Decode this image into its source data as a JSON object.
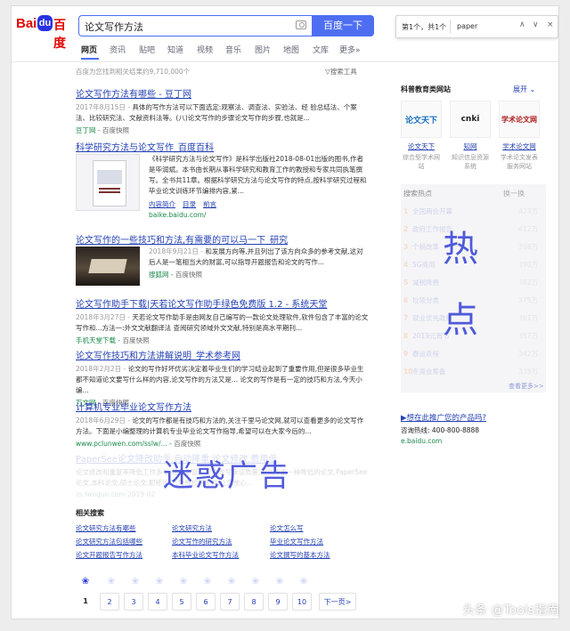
{
  "header": {
    "logo_left": "Bai",
    "logo_paw": "du",
    "logo_right": "百度",
    "query": "论文写作方法",
    "search_button": "百度一下"
  },
  "findbar": {
    "count": "第1个，共1个",
    "term": "paper",
    "up": "∧",
    "down": "∨",
    "close": "×"
  },
  "nav": [
    "网页",
    "资讯",
    "贴吧",
    "知道",
    "视频",
    "音乐",
    "图片",
    "地图",
    "文库",
    "更多»"
  ],
  "result_count": "百度为您找到相关结果约9,710,000个",
  "search_tools": "搜索工具",
  "results": [
    {
      "title": "论文写作方法有哪些 - 豆丁网",
      "date": "2017年8月15日 -",
      "desc": "具体的写作方法可以下面选定:观察法、调查法、实验法、经 验总结法、个案法、比较研究法、文献资料法等。(八)论文写作的步骤论文写作的步骤,也就是...",
      "source": "豆丁网",
      "cache": "百度快照"
    },
    {
      "title": "科学研究方法与论文写作_百度百科",
      "desc": "《科学研究方法与论文写作》是科学出版社2018-08-01出版的图书,作者是毕润斌。本书由长期从事科学研究和教育工作的教授和专家共同执笔撰写。全书共11章。根据科学研究方法与论文写作的特点,按科学研究过程和毕业论文训练环节编排内容,紧...",
      "links": [
        "内容简介",
        "目录",
        "前言"
      ],
      "source": "baike.baidu.com/"
    },
    {
      "title": "论文写作的一些技巧和方法,有需要的可以马一下_研究",
      "date": "2018年9月21日 -",
      "desc": "和发展方向等,并且列出了该方向众多的参考文献,这对后人是一笔相当大的财富,可以指导开题报告和论文的写作...",
      "source": "搜狐网",
      "cache": "百度快照"
    },
    {
      "title": "论文写作助手下载|天若论文写作助手绿色免费版 1.2 - 系统天堂",
      "date": "2018年3月27日 -",
      "desc": "天若论文写作助手是由网友自己编写的一款论文处理软件,软件包含了丰富的论文写作和...方法一:外文文献翻译法 查阅研究领域外文文献,特别是高水平期刊...",
      "source": "手机天堂下载",
      "cache": "百度快照"
    },
    {
      "title": "论文写作技巧和方法讲解说明_学术参考网",
      "date": "2018年2月2日 -",
      "desc": "论文的写作好坏优劣决定着毕业生们的学习结业起到了重要作用,但是很多毕业生都不知道论文要写什么样的内容,论文写作的方法又是... 论文的写作是有一定的技巧和方法,今天小编...",
      "source": "万文网",
      "cache": "百度快照"
    },
    {
      "title": "计算机专业毕业论文写作方法",
      "date": "2018年6月29日 -",
      "desc": "论文的写作都是有技巧和方法的,关注千里马论文网,就可以查看更多的论文写作方法。下面是小编整理的计算机专业毕业论文写作指导,希望可以在大家今后的...",
      "source": "www.pclunwen.com/sslw/...",
      "cache": "百度快照"
    },
    {
      "title": "PaperSee论文降改助手,自动降重,论文修改,费用低",
      "desc": "论文修改和重复率降低工作多年,经验丰富。论文改写保证质量,论文降重一种降低的论文,PaperSee论文,本科论文,硕士论文,职称论文,免费检测论文,让您放心...",
      "source": "zs.lwnguo.com",
      "cache": "2019-02"
    }
  ],
  "overlays": {
    "ad": "迷惑广告",
    "hot_1": "热",
    "hot_2": "点"
  },
  "related": {
    "title": "相关搜索",
    "items": [
      "论文研究方法有哪些",
      "论文研究方法",
      "论文怎么写",
      "论文研究方法包括哪些",
      "论文写作的研究方法",
      "毕业论文写作方法",
      "论文开题报告写作方法",
      "本科毕业论文写作方法",
      "论文撰写的基本方法"
    ]
  },
  "pagination": {
    "pages": [
      "1",
      "2",
      "3",
      "4",
      "5",
      "6",
      "7",
      "8",
      "9",
      "10"
    ],
    "current": "1",
    "next": "下一页>"
  },
  "sidebar": {
    "title": "科普教育类网站",
    "expand": "展开",
    "sites": [
      {
        "logo": "论文天下",
        "name": "论文天下",
        "desc": "综合型学术网站"
      },
      {
        "logo": "cnki",
        "name": "知网",
        "desc": "知识信息资源系统"
      },
      {
        "logo": "学术论文网",
        "name": "学术论文网",
        "desc": "学术论文发表服务网站"
      }
    ],
    "hot_title": "搜索热点",
    "hot_refresh": "换一换",
    "hot_list": [
      {
        "n": "1",
        "k": "全国两会开幕",
        "v": "423万"
      },
      {
        "n": "2",
        "k": "政府工作报告",
        "v": "412万"
      },
      {
        "n": "3",
        "k": "个税改革",
        "v": "398万"
      },
      {
        "n": "4",
        "k": "5G商用",
        "v": "390万"
      },
      {
        "n": "5",
        "k": "减税降费",
        "v": "382万"
      },
      {
        "n": "6",
        "k": "垃圾分类",
        "v": "375万"
      },
      {
        "n": "7",
        "k": "就业优先政策",
        "v": "361万"
      },
      {
        "n": "8",
        "k": "2019元宵节",
        "v": "357万"
      },
      {
        "n": "9",
        "k": "春运返程",
        "v": "342万"
      },
      {
        "n": "10",
        "k": "冬奥会筹备",
        "v": "335万"
      }
    ],
    "hot_more": "查看更多>>",
    "promo_link": "▶想在此推广您的产品吗?",
    "promo_phone": "咨询热线: 400-800-8888",
    "promo_url": "e.baidu.com"
  },
  "watermark": "头条 @Tools指南"
}
